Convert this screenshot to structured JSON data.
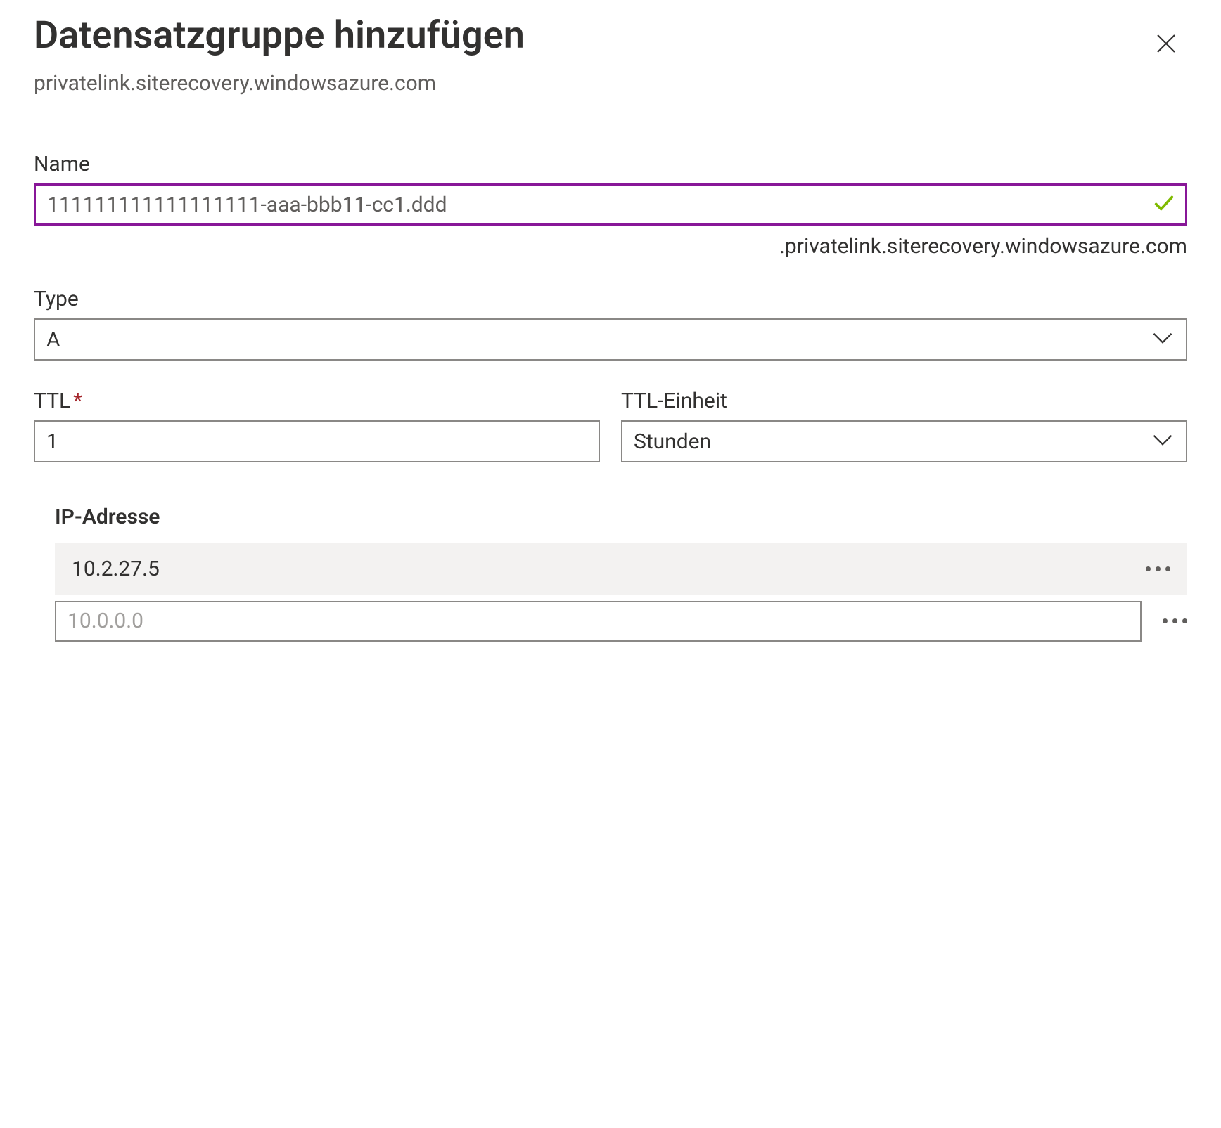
{
  "header": {
    "title": "Datensatzgruppe hinzufügen",
    "subtitle": "privatelink.siterecovery.windowsazure.com"
  },
  "fields": {
    "name": {
      "label": "Name",
      "value": "111111111111111111-aaa-bbb11-cc1.ddd",
      "suffix": ".privatelink.siterecovery.windowsazure.com"
    },
    "type": {
      "label": "Type",
      "value": "A"
    },
    "ttl": {
      "label": "TTL",
      "value": "1"
    },
    "ttl_unit": {
      "label": "TTL-Einheit",
      "value": "Stunden"
    }
  },
  "ip_section": {
    "label": "IP-Adresse",
    "rows": [
      {
        "value": "10.2.27.5"
      }
    ],
    "placeholder": "10.0.0.0"
  }
}
